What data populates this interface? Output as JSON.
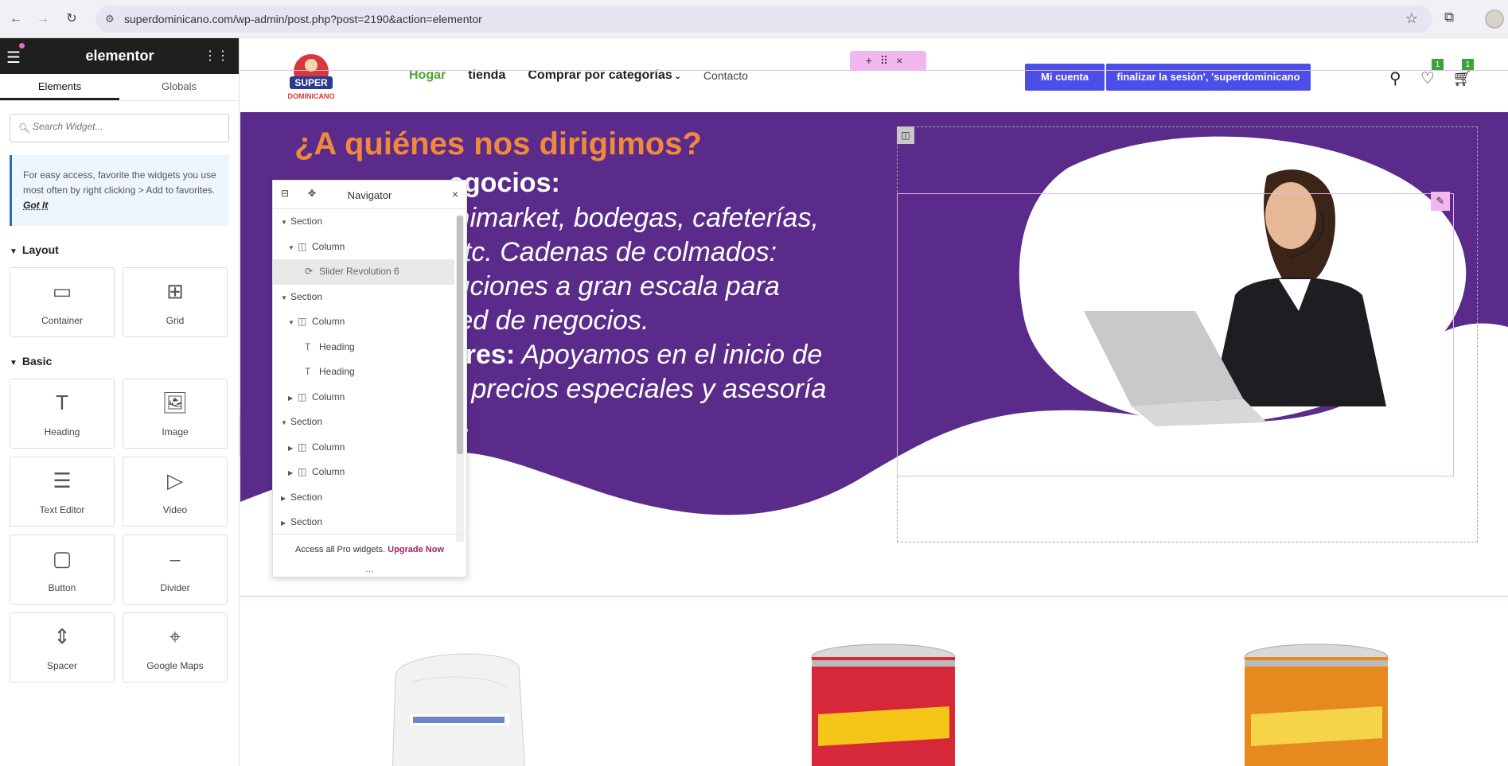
{
  "browser": {
    "url": "superdominicano.com/wp-admin/post.php?post=2190&action=elementor"
  },
  "sidebar": {
    "title": "elementor",
    "tabs": [
      "Elements",
      "Globals"
    ],
    "search_placeholder": "Search Widget...",
    "tip_text": "For easy access, favorite the widgets you use most often by right clicking > Add to favorites.",
    "tip_link": "Got It",
    "layout_label": "Layout",
    "basic_label": "Basic",
    "layout_widgets": [
      {
        "label": "Container",
        "icon": "container-icon"
      },
      {
        "label": "Grid",
        "icon": "grid-icon"
      }
    ],
    "basic_widgets": [
      {
        "label": "Heading",
        "icon": "heading-icon"
      },
      {
        "label": "Image",
        "icon": "image-icon"
      },
      {
        "label": "Text Editor",
        "icon": "text-editor-icon"
      },
      {
        "label": "Video",
        "icon": "video-icon"
      },
      {
        "label": "Button",
        "icon": "button-icon"
      },
      {
        "label": "Divider",
        "icon": "divider-icon"
      },
      {
        "label": "Spacer",
        "icon": "spacer-icon"
      },
      {
        "label": "Google Maps",
        "icon": "map-icon"
      }
    ]
  },
  "site": {
    "menu": [
      "Hogar",
      "tienda",
      "Comprar por categorías",
      "Contacto"
    ],
    "account_btn": "Mi cuenta",
    "logout_btn": "finalizar la sesión', 'superdominicano",
    "wishlist_count": "1",
    "cart_count": "1"
  },
  "hero": {
    "title": "¿A quiénes nos dirigimos?",
    "lines": [
      "egocios:",
      "inimarket, bodegas, cafeterías,",
      "etc. Cadenas de colmados:",
      "luciones a gran escala para",
      "red de negocios."
    ],
    "line6_bold": "ores:",
    "line6_rest": " Apoyamos en el inicio de",
    "line7": "n precios especiales y asesoría",
    "line8": "a."
  },
  "navigator": {
    "title": "Navigator",
    "items": [
      {
        "label": "Section",
        "level": 0,
        "expanded": true
      },
      {
        "label": "Column",
        "level": 1,
        "expanded": true
      },
      {
        "label": "Slider Revolution 6",
        "level": 2,
        "selected": true
      },
      {
        "label": "Section",
        "level": 0,
        "expanded": true
      },
      {
        "label": "Column",
        "level": 1,
        "expanded": true
      },
      {
        "label": "Heading",
        "level": 2
      },
      {
        "label": "Heading",
        "level": 2
      },
      {
        "label": "Column",
        "level": 1,
        "expanded": false
      },
      {
        "label": "Section",
        "level": 0,
        "expanded": true
      },
      {
        "label": "Column",
        "level": 1,
        "expanded": false
      },
      {
        "label": "Column",
        "level": 1,
        "expanded": false
      },
      {
        "label": "Section",
        "level": 0,
        "expanded": false
      },
      {
        "label": "Section",
        "level": 0,
        "expanded": false
      }
    ],
    "footer_text": "Access all Pro widgets.",
    "footer_link": "Upgrade Now"
  },
  "colors": {
    "hero_purple": "#5a2b8a",
    "hero_title": "#f0893b",
    "menu_active": "#48a827",
    "button_blue": "#4b4fe8"
  }
}
